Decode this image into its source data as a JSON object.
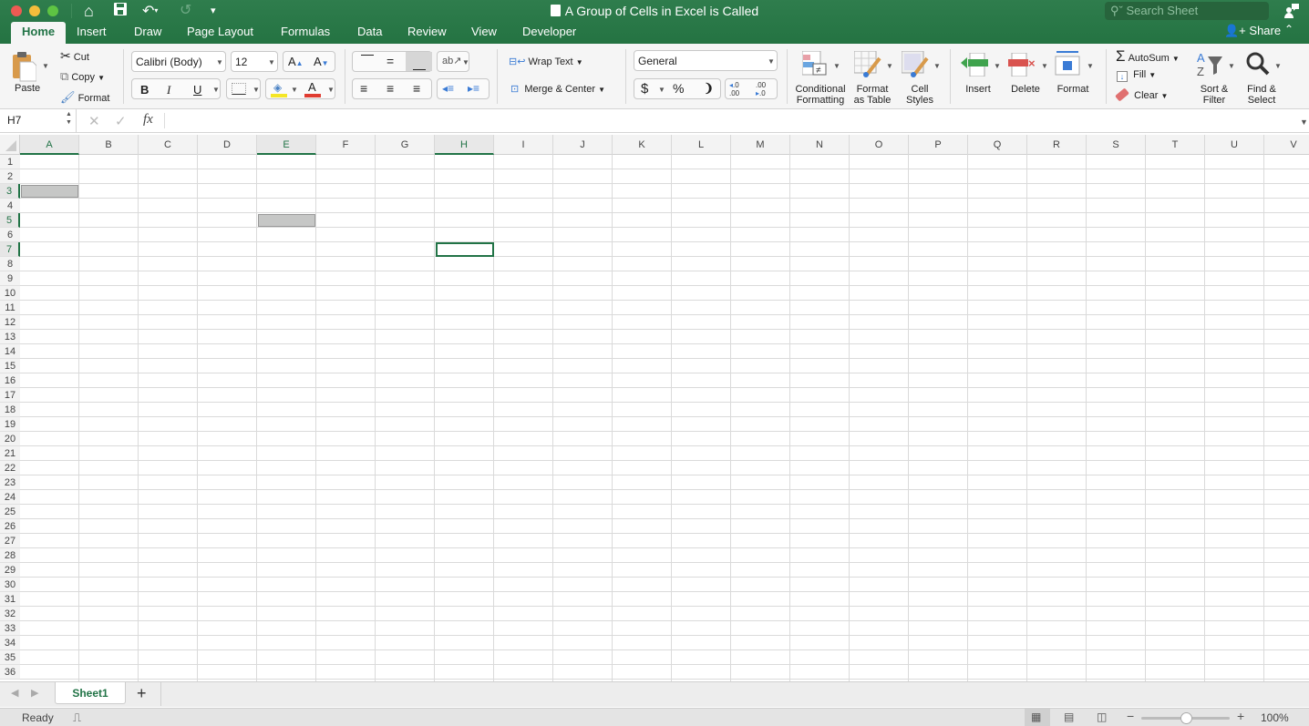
{
  "window": {
    "title": "A Group of Cells in Excel is Called",
    "search_placeholder": "Search Sheet",
    "share_label": "Share"
  },
  "quick_access": {
    "home_icon": "⌂",
    "save_icon": "💾",
    "undo_icon": "↶",
    "redo_icon": "↺",
    "customize_icon": "▾"
  },
  "tabs": [
    {
      "label": "Home",
      "active": true
    },
    {
      "label": "Insert"
    },
    {
      "label": "Draw"
    },
    {
      "label": "Page Layout"
    },
    {
      "label": "Formulas"
    },
    {
      "label": "Data"
    },
    {
      "label": "Review"
    },
    {
      "label": "View"
    },
    {
      "label": "Developer"
    }
  ],
  "ribbon": {
    "clipboard": {
      "paste": "Paste",
      "cut": "Cut",
      "copy": "Copy",
      "format": "Format"
    },
    "font": {
      "name": "Calibri (Body)",
      "size": "12",
      "grow": "A▴",
      "shrink": "A▾",
      "bold": "B",
      "italic": "I",
      "underline": "U"
    },
    "alignment": {
      "wrap_text": "Wrap Text",
      "merge_center": "Merge & Center"
    },
    "number": {
      "format": "General",
      "currency": "$",
      "percent": "%",
      "comma": "❩",
      "inc_decimal": ".0 .00",
      "dec_decimal": ".00 .0"
    },
    "styles": {
      "conditional": "Conditional\nFormatting",
      "conditional_l1": "Conditional",
      "conditional_l2": "Formatting",
      "table_l1": "Format",
      "table_l2": "as Table",
      "cell_l1": "Cell",
      "cell_l2": "Styles"
    },
    "cells": {
      "insert": "Insert",
      "delete": "Delete",
      "format": "Format"
    },
    "editing": {
      "autosum": "AutoSum",
      "fill": "Fill",
      "clear": "Clear",
      "sort_l1": "Sort &",
      "sort_l2": "Filter",
      "find_l1": "Find &",
      "find_l2": "Select"
    }
  },
  "formula_bar": {
    "name_box": "H7",
    "cancel": "✕",
    "enter": "✓",
    "fx": "fx",
    "value": ""
  },
  "grid": {
    "columns": [
      "A",
      "B",
      "C",
      "D",
      "E",
      "F",
      "G",
      "H",
      "I",
      "J",
      "K",
      "L",
      "M",
      "N",
      "O",
      "P",
      "Q",
      "R",
      "S",
      "T",
      "U",
      "V"
    ],
    "rows": 36,
    "selected_columns": [
      "A",
      "E",
      "H"
    ],
    "selected_rows": [
      3,
      5,
      7
    ],
    "highlighted_cells": [
      "A3",
      "E5"
    ],
    "active_cell": "H7"
  },
  "sheets": [
    {
      "name": "Sheet1",
      "active": true
    }
  ],
  "add_sheet": "+",
  "status": {
    "text": "Ready",
    "zoom": "100%",
    "zoom_percent": 100
  }
}
